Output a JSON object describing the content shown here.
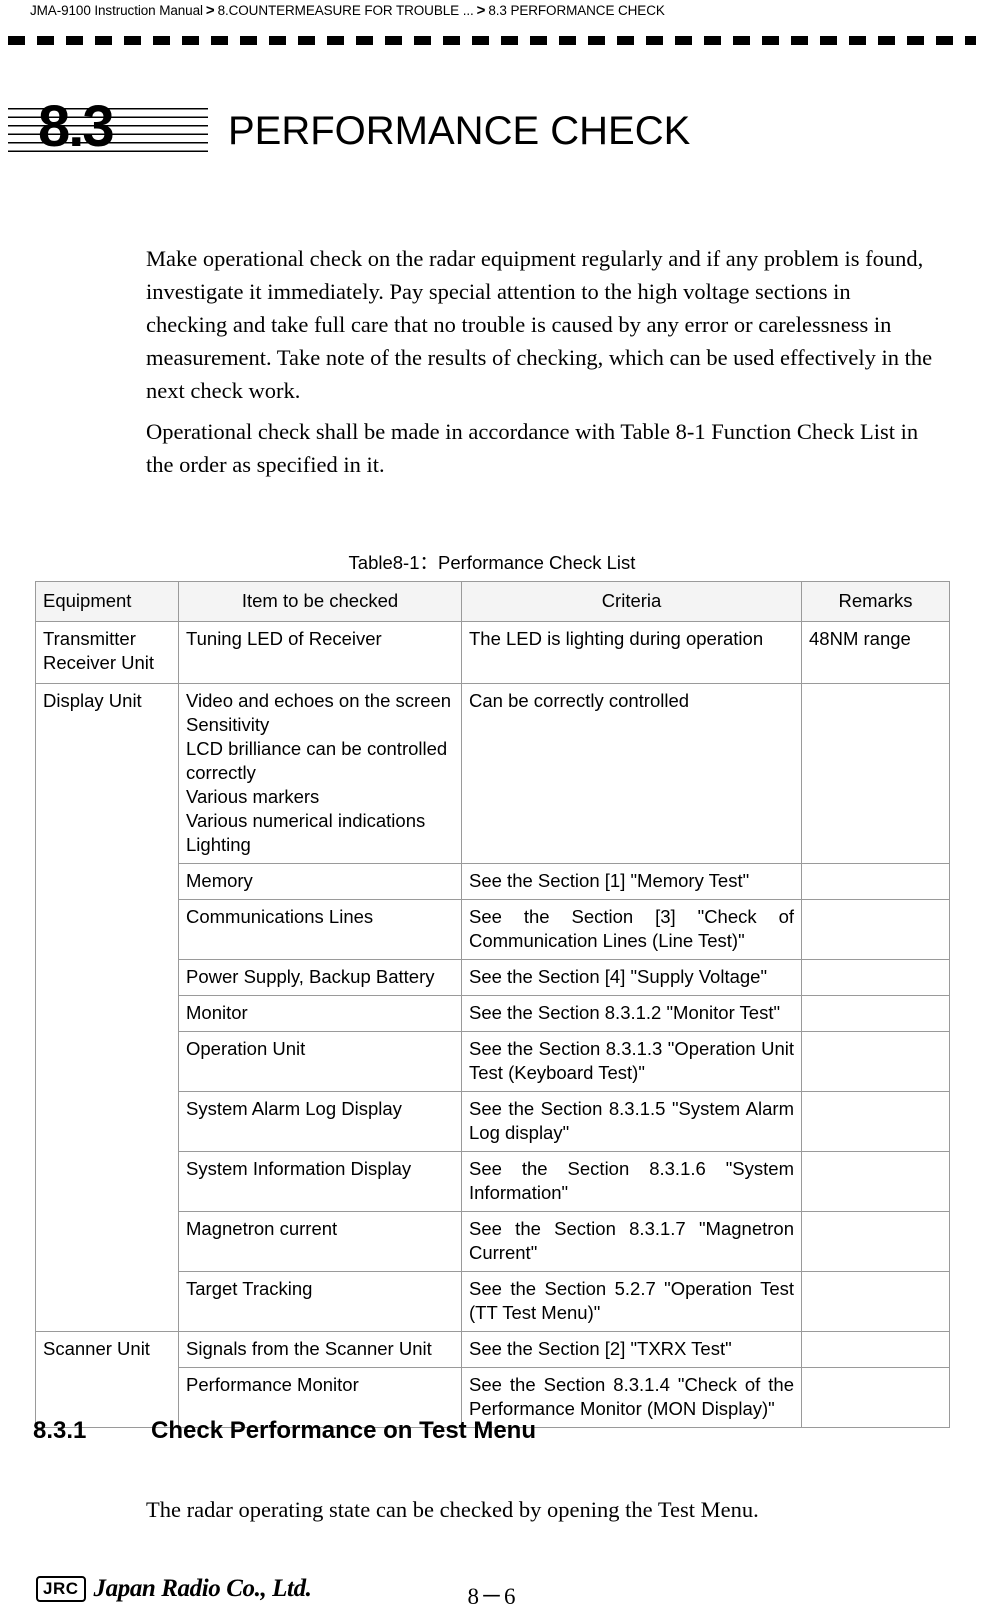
{
  "breadcrumb": {
    "manual": "JMA-9100 Instruction Manual",
    "sep": ">",
    "chapter": "8.COUNTERMEASURE FOR TROUBLE ...",
    "section": "8.3  PERFORMANCE CHECK"
  },
  "chapter": {
    "number": "8.3",
    "title": "PERFORMANCE CHECK"
  },
  "paragraphs": {
    "p1": "Make operational check on the radar equipment regularly and if any problem is found, investigate it immediately.  Pay special attention to the high voltage sections in checking and take full care that no trouble is caused by any error or carelessness in measurement. Take note of the results of checking, which can be used effectively in the next check work.",
    "p2": "Operational check shall be made in accordance with Table 8-1 Function Check List in the order as specified in it."
  },
  "table": {
    "caption": "Table8-1：Performance Check List",
    "headers": [
      "Equipment",
      "Item to be checked",
      "Criteria",
      "Remarks"
    ],
    "rows": [
      {
        "equipment": "Transmitter\nReceiver Unit",
        "item": "Tuning LED of Receiver",
        "criteria": "The LED is lighting during operation",
        "remarks": "48NM range"
      },
      {
        "equipment": "Display Unit",
        "item": "Video and echoes on the screen Sensitivity\nLCD brilliance can be controlled correctly\nVarious markers\nVarious numerical indications\nLighting",
        "criteria": "Can be correctly controlled",
        "remarks": ""
      },
      {
        "equipment": "",
        "item": "Memory",
        "criteria": "See the Section [1] \"Memory Test\"",
        "remarks": ""
      },
      {
        "equipment": "",
        "item": "Communications Lines",
        "criteria": "See the Section [3] \"Check of Communication Lines (Line Test)\"",
        "remarks": ""
      },
      {
        "equipment": "",
        "item": "Power Supply, Backup Battery",
        "criteria": "See the Section [4] \"Supply Voltage\"",
        "remarks": ""
      },
      {
        "equipment": "",
        "item": "Monitor",
        "criteria": "See the Section 8.3.1.2 \"Monitor Test\"",
        "remarks": ""
      },
      {
        "equipment": "",
        "item": "Operation Unit",
        "criteria": "See the Section 8.3.1.3 \"Operation Unit Test (Keyboard Test)\"",
        "remarks": ""
      },
      {
        "equipment": "",
        "item": "System Alarm Log Display",
        "criteria": "See the Section 8.3.1.5 \"System Alarm Log display\"",
        "remarks": ""
      },
      {
        "equipment": "",
        "item": "System Information Display",
        "criteria": "See the Section 8.3.1.6 \"System Information\"",
        "remarks": ""
      },
      {
        "equipment": "",
        "item": "Magnetron current",
        "criteria": "See the Section 8.3.1.7 \"Magnetron Current\"",
        "remarks": ""
      },
      {
        "equipment": "",
        "item": "Target Tracking",
        "criteria": "See the Section 5.2.7 \"Operation Test (TT Test Menu)\"",
        "remarks": ""
      },
      {
        "equipment": "Scanner Unit",
        "item": "Signals from the Scanner Unit",
        "criteria": "See the Section [2] \"TXRX Test\"",
        "remarks": ""
      },
      {
        "equipment": "",
        "item": "Performance Monitor",
        "criteria": "See the Section 8.3.1.4 \"Check of the Performance Monitor (MON Display)\"",
        "remarks": ""
      }
    ]
  },
  "subsection": {
    "number": "8.3.1",
    "title": "Check Performance on Test Menu",
    "text": "The radar operating state can be checked by opening the Test Menu."
  },
  "footer": {
    "logo_mark": "JRC",
    "company": "Japan Radio Co., Ltd.",
    "page": "8－6"
  }
}
